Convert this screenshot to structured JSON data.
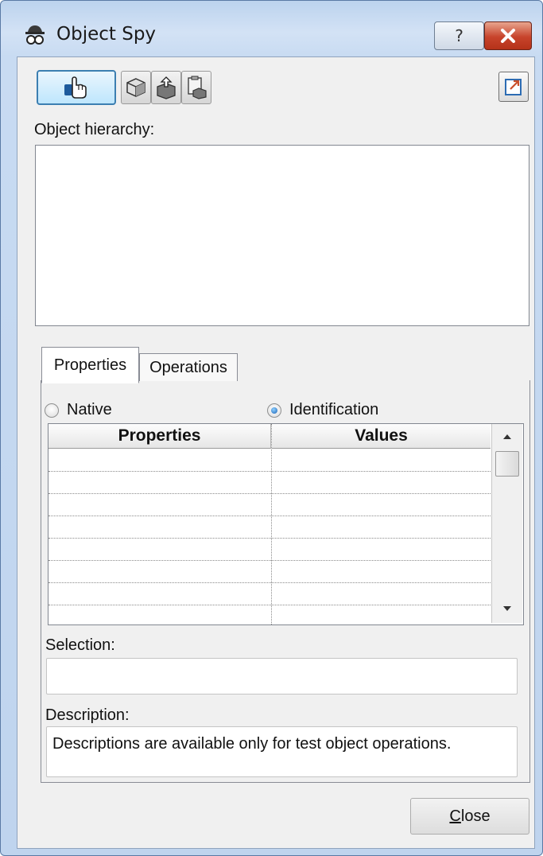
{
  "window": {
    "title": "Object Spy",
    "help_icon": "question-mark-icon",
    "close_icon": "close-x-icon"
  },
  "toolbar": {
    "pointer_icon": "pointing-hand-icon",
    "buttons": [
      "object-cube-icon",
      "parent-object-icon",
      "copy-object-icon"
    ],
    "export_icon": "export-icon"
  },
  "hierarchy": {
    "label": "Object hierarchy:"
  },
  "tabs": [
    {
      "label": "Properties",
      "active": true
    },
    {
      "label": "Operations",
      "active": false
    }
  ],
  "mode": {
    "native_label": "Native",
    "identification_label": "Identification",
    "selected": "identification"
  },
  "grid": {
    "columns": [
      "Properties",
      "Values"
    ],
    "row_count": 7
  },
  "selection": {
    "label": "Selection:",
    "value": ""
  },
  "description": {
    "label": "Description:",
    "text": "Descriptions are available only for test object operations."
  },
  "footer": {
    "close_label_first": "C",
    "close_label_rest": "lose"
  },
  "colors": {
    "frame": "#bfd4ee",
    "client": "#f0f0f0",
    "close_red": "#c7432b",
    "accent_blue": "#3c7fb1"
  }
}
